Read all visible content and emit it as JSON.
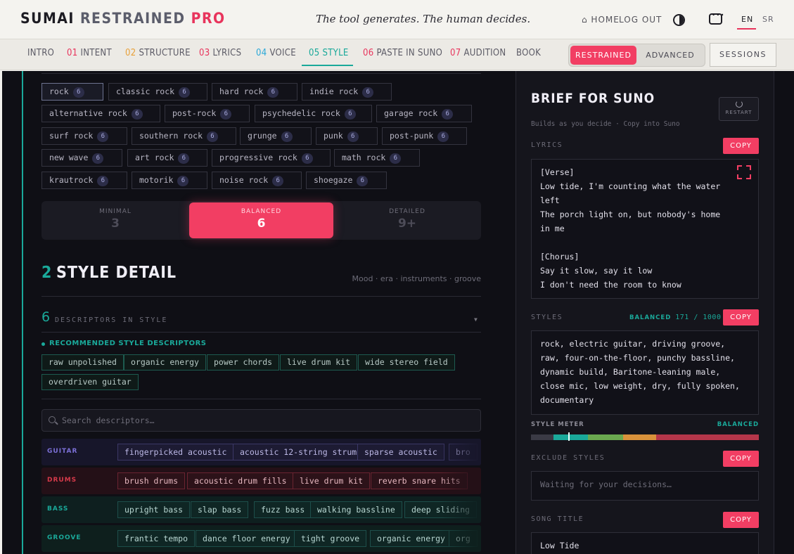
{
  "header": {
    "brand_1": "SUMAI",
    "brand_2": "RESTRAINED",
    "brand_3": "PRO",
    "tagline": "The tool generates. The human decides.",
    "home": "⌂ HOME",
    "logout": "LOG OUT",
    "lang_en": "EN",
    "lang_sr": "SR"
  },
  "nav": {
    "tabs": [
      {
        "num": "",
        "label": "INTRO",
        "num_color": ""
      },
      {
        "num": "01",
        "label": "INTENT",
        "num_color": "#e8345c"
      },
      {
        "num": "02",
        "label": "STRUCTURE",
        "num_color": "#e8a13a"
      },
      {
        "num": "03",
        "label": "LYRICS",
        "num_color": "#e8345c"
      },
      {
        "num": "04",
        "label": "VOICE",
        "num_color": "#2aa8d8"
      },
      {
        "num": "05",
        "label": "STYLE",
        "num_color": "#1aa99a"
      },
      {
        "num": "06",
        "label": "PASTE IN SUNO",
        "num_color": "#e8345c"
      },
      {
        "num": "07",
        "label": "AUDITION",
        "num_color": "#e8345c"
      },
      {
        "num": "",
        "label": "BOOK",
        "num_color": ""
      }
    ],
    "mode_restrained": "RESTRAINED",
    "mode_advanced": "ADVANCED",
    "sessions": "SESSIONS"
  },
  "genres": [
    {
      "label": "rock",
      "count": "6",
      "selected": true
    },
    {
      "label": "classic rock",
      "count": "6"
    },
    {
      "label": "hard rock",
      "count": "6"
    },
    {
      "label": "indie rock",
      "count": "6"
    },
    {
      "label": "alternative rock",
      "count": "6"
    },
    {
      "label": "post-rock",
      "count": "6"
    },
    {
      "label": "psychedelic rock",
      "count": "6"
    },
    {
      "label": "garage rock",
      "count": "6"
    },
    {
      "label": "surf rock",
      "count": "6"
    },
    {
      "label": "southern rock",
      "count": "6"
    },
    {
      "label": "grunge",
      "count": "6"
    },
    {
      "label": "punk",
      "count": "6"
    },
    {
      "label": "post-punk",
      "count": "6"
    },
    {
      "label": "new wave",
      "count": "6"
    },
    {
      "label": "art rock",
      "count": "6"
    },
    {
      "label": "progressive rock",
      "count": "6"
    },
    {
      "label": "math rock",
      "count": "6"
    },
    {
      "label": "krautrock",
      "count": "6"
    },
    {
      "label": "motorik",
      "count": "6"
    },
    {
      "label": "noise rock",
      "count": "6"
    },
    {
      "label": "shoegaze",
      "count": "6"
    }
  ],
  "density": {
    "minimal_label": "MINIMAL",
    "minimal_value": "3",
    "balanced_label": "BALANCED",
    "balanced_value": "6",
    "detailed_label": "DETAILED",
    "detailed_value": "9+",
    "selected": "balanced"
  },
  "style_detail": {
    "number": "2",
    "title": "STYLE DETAIL",
    "subtitle": "Mood · era · instruments · groove",
    "descriptor_count": "6",
    "descriptor_label": "DESCRIPTORS IN STYLE",
    "recommended_label": "RECOMMENDED STYLE DESCRIPTORS",
    "recommended": [
      "raw unpolished",
      "organic energy",
      "power chords",
      "live drum kit",
      "wide stereo field",
      "overdriven guitar"
    ],
    "search_placeholder": "Search descriptors…",
    "categories": [
      {
        "label": "GUITAR",
        "color": "#7b6fd6",
        "items": [
          "fingerpicked acoustic",
          "acoustic 12-string strum",
          "sparse acoustic",
          "bro"
        ]
      },
      {
        "label": "DRUMS",
        "color": "#d63a4a",
        "items": [
          "brush drums",
          "acoustic drum fills",
          "live drum kit",
          "reverb snare hits"
        ]
      },
      {
        "label": "BASS",
        "color": "#1aa99a",
        "items": [
          "upright bass",
          "slap bass",
          "fuzz bass",
          "walking bassline",
          "deep sliding"
        ]
      },
      {
        "label": "GROOVE",
        "color": "#1aa99a",
        "items": [
          "frantic tempo",
          "dance floor energy",
          "tight groove",
          "organic energy",
          "org"
        ]
      }
    ]
  },
  "brief": {
    "title": "BRIEF FOR SUNO",
    "subtitle": "Builds as you decide · Copy into Suno",
    "restart": "RESTART",
    "lyrics_label": "LYRICS",
    "copy": "COPY",
    "lyrics": "[Verse]\nLow tide, I'm counting what the water\nleft\nThe porch light on, but nobody's home\nin me\n\n[Chorus]\nSay it slow, say it low\nI don't need the room to know",
    "styles_label": "STYLES",
    "styles_level": "BALANCED",
    "styles_count": "171 / 1000",
    "styles_text": "rock, electric guitar, driving groove,\nraw, four-on-the-floor, punchy bassline,\ndynamic build, Baritone-leaning male,\nclose mic, low weight, dry, fully spoken,\ndocumentary",
    "meter_label": "STYLE METER",
    "meter_level": "BALANCED",
    "meter_value": 0.165,
    "exclude_label": "EXCLUDE STYLES",
    "exclude_placeholder": "Waiting for your decisions…",
    "title_label": "SONG TITLE",
    "song_title": "Low Tide"
  }
}
